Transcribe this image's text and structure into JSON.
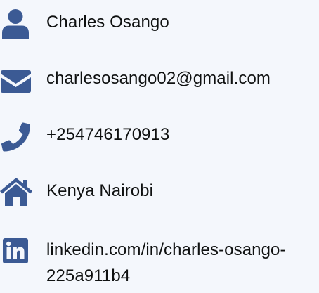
{
  "accent_color": "#3b5a94",
  "contact": {
    "name": {
      "icon": "user-icon",
      "text": "Charles Osango"
    },
    "email": {
      "icon": "envelope-icon",
      "text": "charlesosango02@gmail.com"
    },
    "phone": {
      "icon": "phone-icon",
      "text": "+254746170913"
    },
    "location": {
      "icon": "home-icon",
      "text": "Kenya Nairobi"
    },
    "linkedin": {
      "icon": "linkedin-icon",
      "text": "linkedin.com/in/charles-osango-225a911b4"
    }
  }
}
